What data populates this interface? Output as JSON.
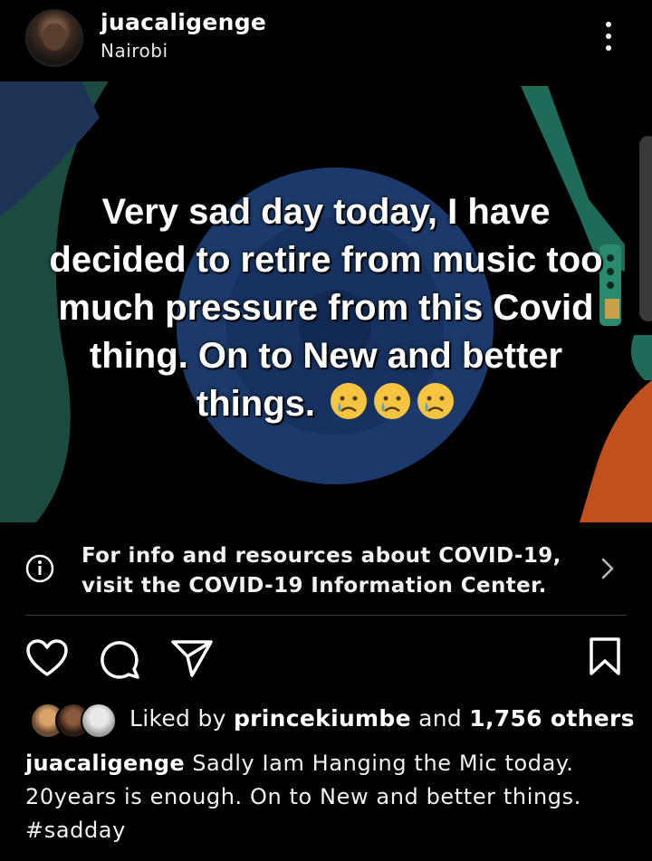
{
  "header": {
    "username": "juacaligenge",
    "location": "Nairobi"
  },
  "post": {
    "image_text": "Very sad day today, I have decided to retire from music too much pressure from this Covid thing. On to New and better things.",
    "emojis": [
      "crying-face",
      "crying-face",
      "crying-face"
    ]
  },
  "covid_banner": {
    "line1": "For info and resources about COVID-19,",
    "line2": "visit the COVID-19 Information Center."
  },
  "likes": {
    "prefix": "Liked by",
    "user": "princekiumbe",
    "middle": "and",
    "others": "1,756 others"
  },
  "caption": {
    "username": "juacaligenge",
    "text": "Sadly Iam Hanging the Mic today. 20years is enough. On to New and better things.",
    "hashtag": "#sadday"
  },
  "colors": {
    "background": "#000000",
    "record_blue": "#1b3a6b",
    "teal": "#1f6b5a",
    "orange": "#c2501c"
  }
}
